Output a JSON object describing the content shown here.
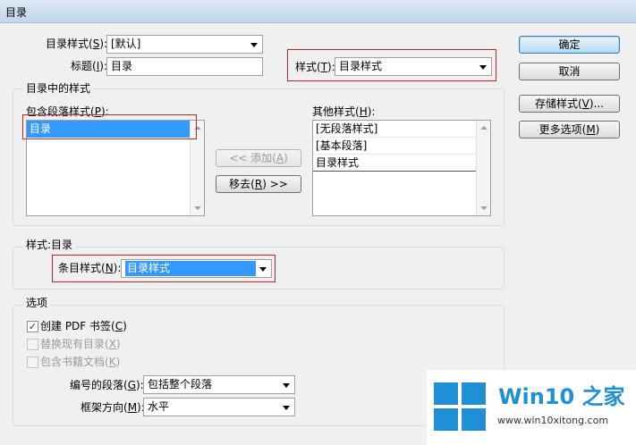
{
  "window": {
    "title": "目录"
  },
  "top": {
    "toc_style_label": "目录样式(",
    "toc_style_key": "S",
    "toc_style_suffix": "):",
    "toc_style_value": "[默认]",
    "title_label": "标题(",
    "title_key": "I",
    "title_suffix": "):",
    "title_value": "目录",
    "style_label": "样式(",
    "style_key": "T",
    "style_suffix": "):",
    "style_value": "目录样式"
  },
  "buttons": {
    "ok": "确定",
    "cancel": "取消",
    "save_style": "存储样式(",
    "save_style_key": "V",
    "save_style_suffix": ")...",
    "more_options": "更多选项(",
    "more_options_key": "M",
    "more_options_suffix": ")",
    "add": "<< 添加(",
    "add_key": "A",
    "add_suffix": ")",
    "remove": "移去(",
    "remove_key": "R",
    "remove_suffix": ") >>"
  },
  "styles_in_toc": {
    "group_label": "目录中的样式",
    "include_label": "包含段落样式(",
    "include_key": "P",
    "include_suffix": "):",
    "include_items": [
      "目录"
    ],
    "other_label": "其他样式(",
    "other_key": "H",
    "other_suffix": "):",
    "other_items": [
      "[无段落样式]",
      "[基本段落]",
      "目录样式"
    ]
  },
  "style_section": {
    "group_label": "样式:目录",
    "entry_style_label": "条目样式(",
    "entry_style_key": "N",
    "entry_style_suffix": "):",
    "entry_style_value": "目录样式"
  },
  "options": {
    "group_label": "选项",
    "pdf_bookmarks": {
      "label": "创建 PDF 书签(",
      "key": "C",
      "suffix": ")",
      "checked": true
    },
    "replace_existing": {
      "label": "替换现有目录(",
      "key": "X",
      "suffix": ")",
      "checked": false
    },
    "include_book": {
      "label": "包含书籍文档(",
      "key": "K",
      "suffix": ")",
      "checked": false
    },
    "numbered_label": "编号的段落(",
    "numbered_key": "G",
    "numbered_suffix": "):",
    "numbered_value": "包括整个段落",
    "frame_dir_label": "框架方向(",
    "frame_dir_key": "M",
    "frame_dir_suffix": "):",
    "frame_dir_value": "水平"
  },
  "watermark": {
    "title": "Win10 之家",
    "url": "www.win10xitong.com",
    "color": "#1f8fd6"
  }
}
